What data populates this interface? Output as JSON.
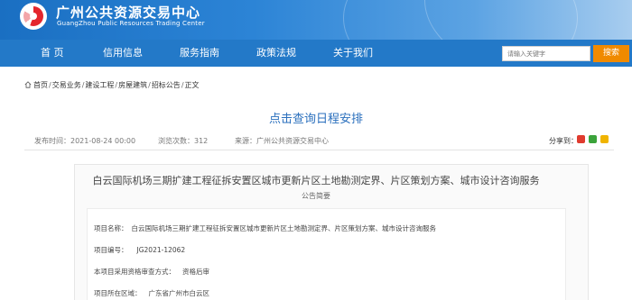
{
  "header": {
    "title": "广州公共资源交易中心",
    "subtitle": "GuangZhou Public Resources Trading Center",
    "logo_icon": "logo-icon"
  },
  "nav": {
    "items": [
      "首 页",
      "信用信息",
      "服务指南",
      "政策法规",
      "关于我们"
    ],
    "search_placeholder": "请输入关键字",
    "search_label": "搜索"
  },
  "breadcrumb": {
    "items": [
      "首页",
      "交易业务",
      "建设工程",
      "房屋建筑",
      "招标公告",
      "正文"
    ]
  },
  "article": {
    "schedule_link": "点击查询日程安排",
    "publish_time": "发布时间：2021-08-24 00:00",
    "view_count": "浏览次数：312",
    "source": "来源：广州公共资源交易中心",
    "share_label": "分享到："
  },
  "doc": {
    "title": "白云国际机场三期扩建工程征拆安置区城市更新片区土地勘测定界、片区策划方案、城市设计咨询服务",
    "subtitle": "公告简要",
    "rows": [
      {
        "label": "项目名称：",
        "value": "白云国际机场三期扩建工程征拆安置区城市更新片区土地勘测定界、片区策划方案、城市设计咨询服务"
      },
      {
        "label": "项目编号：",
        "value": "JG2021-12062"
      },
      {
        "label": "本项目采用资格审查方式：",
        "value": "资格后审"
      },
      {
        "label": "项目所在区域：",
        "value": "广东省广州市白云区"
      }
    ]
  },
  "colors": {
    "nav_bg": "#2379c8",
    "link": "#2a6fbd",
    "search_button": "#f08a00"
  }
}
